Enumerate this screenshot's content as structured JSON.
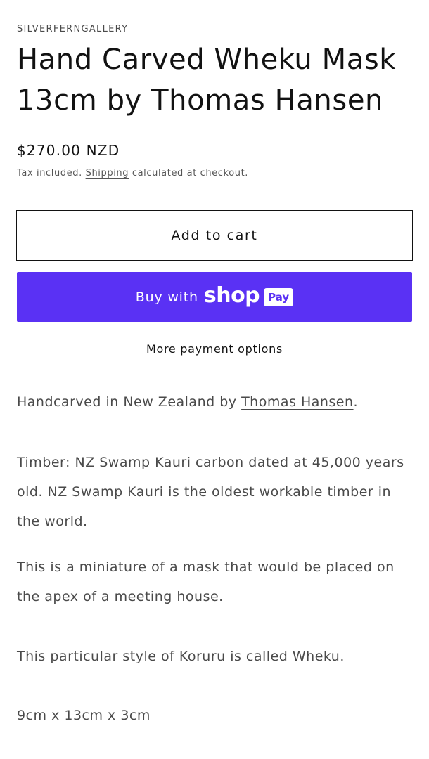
{
  "product": {
    "vendor": "SILVERFERNGALLERY",
    "title": "Hand Carved Wheku Mask 13cm by Thomas Hansen",
    "price": "$270.00 NZD",
    "tax_note_prefix": "Tax included.",
    "shipping_link": "Shipping",
    "tax_note_suffix": "calculated at checkout."
  },
  "actions": {
    "add_to_cart_label": "Add to cart",
    "buy_with_label": "Buy with",
    "shop_logo": "shop",
    "pay_badge": "Pay",
    "more_payment_options": "More payment options"
  },
  "description": {
    "p1_prefix": "Handcarved in New Zealand by",
    "artist_link": "Thomas Hansen",
    "p1_suffix": ".",
    "p2": "Timber: NZ Swamp Kauri carbon dated at 45,000 years old.  NZ Swamp Kauri is the oldest workable timber in the world.",
    "p3": "This is a miniature of a mask that would be placed on the apex of a meeting house.",
    "p4": "This particular style of Koruru is called Wheku.",
    "p5": "9cm x 13cm x 3cm"
  },
  "colors": {
    "shop_pay_purple": "#5a31f4",
    "text_primary": "#121212",
    "text_secondary": "#4a4a4a"
  }
}
